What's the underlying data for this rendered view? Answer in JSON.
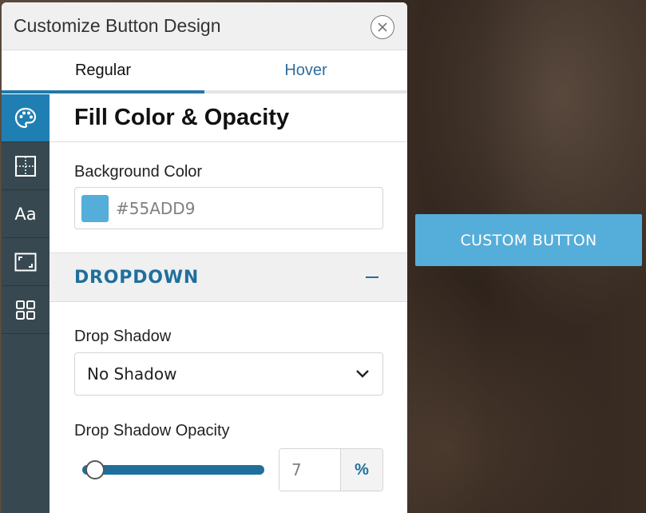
{
  "panel": {
    "title": "Customize Button Design"
  },
  "tabs": [
    {
      "label": "Regular",
      "active": true
    },
    {
      "label": "Hover",
      "active": false
    }
  ],
  "sidebar": {
    "items": [
      {
        "icon": "palette-icon",
        "active": true
      },
      {
        "icon": "grid-layout-icon",
        "active": false
      },
      {
        "icon": "text-format-icon",
        "label": "Aa",
        "active": false
      },
      {
        "icon": "resize-frame-icon",
        "active": false
      },
      {
        "icon": "four-squares-icon",
        "active": false
      }
    ]
  },
  "section": {
    "title": "Fill Color & Opacity",
    "background_color_label": "Background Color",
    "background_color_value": "#55ADD9"
  },
  "dropdown": {
    "title": "DROPDOWN",
    "drop_shadow_label": "Drop Shadow",
    "drop_shadow_value": "No Shadow",
    "drop_shadow_opacity_label": "Drop Shadow Opacity",
    "opacity_value": "7",
    "opacity_unit": "%",
    "opacity_fraction": 0.07
  },
  "preview": {
    "button_label": "CUSTOM BUTTON"
  },
  "colors": {
    "accent": "#1f7fb2",
    "button_fill": "#55add9",
    "sidebar": "#374850",
    "heading_blue": "#1f6f9c"
  }
}
